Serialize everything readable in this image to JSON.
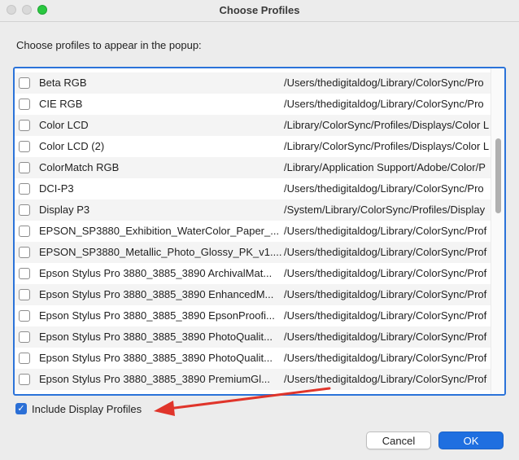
{
  "window": {
    "title": "Choose Profiles"
  },
  "prompt": "Choose profiles to appear in the popup:",
  "profiles": [
    {
      "name": "Beta RGB",
      "path": "/Users/thedigitaldog/Library/ColorSync/Pro",
      "checked": false
    },
    {
      "name": "CIE RGB",
      "path": "/Users/thedigitaldog/Library/ColorSync/Pro",
      "checked": false
    },
    {
      "name": "Color LCD",
      "path": "/Library/ColorSync/Profiles/Displays/Color L",
      "checked": false
    },
    {
      "name": "Color LCD (2)",
      "path": "/Library/ColorSync/Profiles/Displays/Color L",
      "checked": false
    },
    {
      "name": "ColorMatch RGB",
      "path": "/Library/Application Support/Adobe/Color/P",
      "checked": false
    },
    {
      "name": "DCI-P3",
      "path": "/Users/thedigitaldog/Library/ColorSync/Pro",
      "checked": false
    },
    {
      "name": "Display P3",
      "path": "/System/Library/ColorSync/Profiles/Display",
      "checked": false
    },
    {
      "name": "EPSON_SP3880_Exhibition_WaterColor_Paper_...",
      "path": "/Users/thedigitaldog/Library/ColorSync/Prof",
      "checked": false
    },
    {
      "name": "EPSON_SP3880_Metallic_Photo_Glossy_PK_v1....",
      "path": "/Users/thedigitaldog/Library/ColorSync/Prof",
      "checked": false
    },
    {
      "name": "Epson Stylus Pro 3880_3885_3890 ArchivalMat...",
      "path": "/Users/thedigitaldog/Library/ColorSync/Prof",
      "checked": false
    },
    {
      "name": "Epson Stylus Pro 3880_3885_3890 EnhancedM...",
      "path": "/Users/thedigitaldog/Library/ColorSync/Prof",
      "checked": false
    },
    {
      "name": "Epson Stylus Pro 3880_3885_3890 EpsonProofi...",
      "path": "/Users/thedigitaldog/Library/ColorSync/Prof",
      "checked": false
    },
    {
      "name": "Epson Stylus Pro 3880_3885_3890 PhotoQualit...",
      "path": "/Users/thedigitaldog/Library/ColorSync/Prof",
      "checked": false
    },
    {
      "name": "Epson Stylus Pro 3880_3885_3890 PhotoQualit...",
      "path": "/Users/thedigitaldog/Library/ColorSync/Prof",
      "checked": false
    },
    {
      "name": "Epson Stylus Pro 3880_3885_3890 PremiumGl...",
      "path": "/Users/thedigitaldog/Library/ColorSync/Prof",
      "checked": false
    }
  ],
  "include_display": {
    "label": "Include Display Profiles",
    "checked": true,
    "check_glyph": "✓"
  },
  "buttons": {
    "cancel": "Cancel",
    "ok": "OK"
  },
  "colors": {
    "accent": "#2b6fd6",
    "annotation_arrow": "#e0352b"
  },
  "icons": {
    "annotation": "red-arrow-icon"
  }
}
